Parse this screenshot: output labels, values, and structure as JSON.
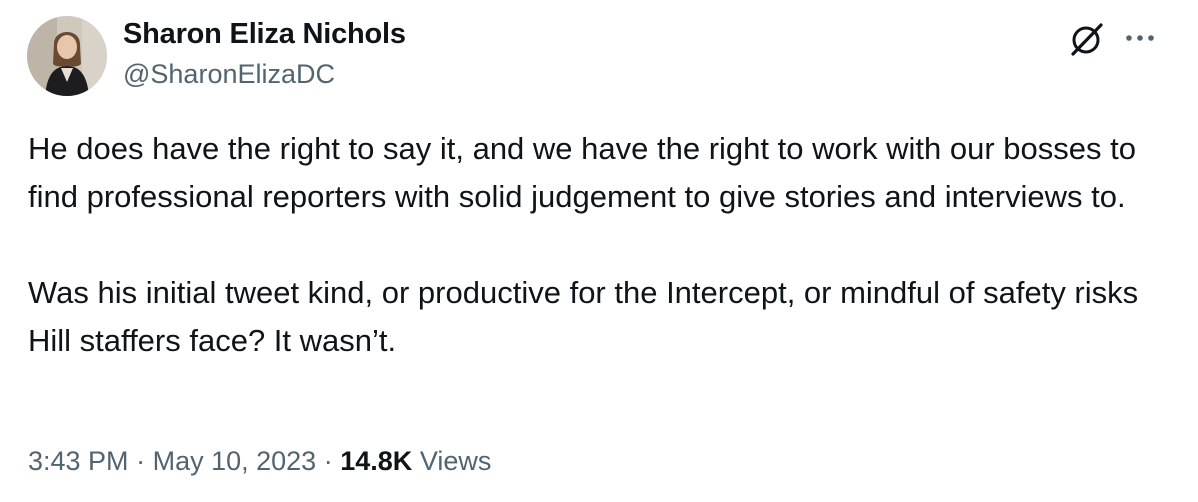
{
  "author": {
    "name": "Sharon Eliza Nichols",
    "handle": "@SharonElizaDC"
  },
  "tweet": {
    "text": "He does have the right to say it, and we have the right to work with our bosses to find professional reporters with solid judgement to give stories and interviews to.\n\nWas his initial tweet kind, or productive for the Intercept, or mindful of safety risks Hill staffers face? It wasn’t."
  },
  "meta": {
    "time": "3:43 PM",
    "separator": "·",
    "date": "May 10, 2023",
    "views_count": "14.8K",
    "views_label": "Views"
  },
  "icons": {
    "grok": "grok-icon",
    "more": "more-horizontal-icon"
  },
  "colors": {
    "text_primary": "#0f1419",
    "text_secondary": "#536471",
    "background": "#ffffff"
  }
}
